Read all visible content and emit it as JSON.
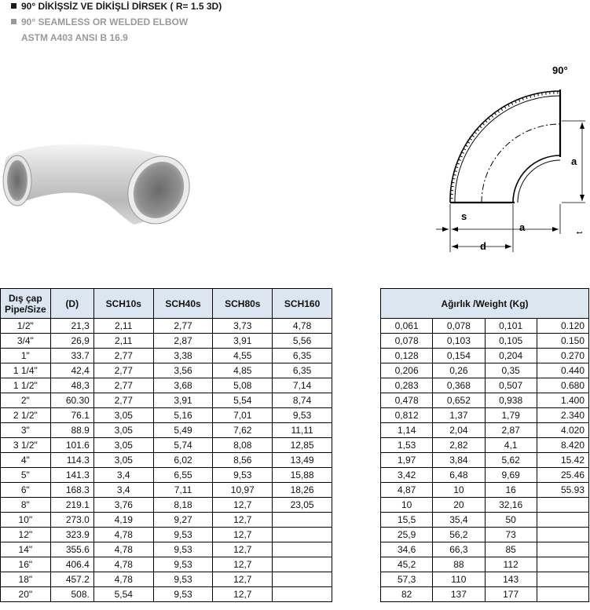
{
  "header": {
    "line1": "90° DİKİŞSİZ VE DİKİŞLİ DİRSEK ( R= 1.5 3D)",
    "line2": "90° SEAMLESS OR WELDED ELBOW",
    "line3": "ASTM A403 ANSI B 16.9"
  },
  "drawing": {
    "angle_label": "90°",
    "label_a_vertical": "a",
    "label_a_horizontal": "a",
    "label_s": "s",
    "label_d": "d",
    "label_t": "t"
  },
  "dims_table": {
    "headers": [
      "Dış çap Pipe/Size",
      "(D)",
      "SCH10s",
      "SCH40s",
      "SCH80s",
      "SCH160"
    ],
    "rows": [
      [
        "1/2\"",
        "21,3",
        "2,11",
        "2,77",
        "3,73",
        "4,78"
      ],
      [
        "3/4\"",
        "26,9",
        "2,11",
        "2,87",
        "3,91",
        "5,56"
      ],
      [
        "1\"",
        "33.7",
        "2,77",
        "3,38",
        "4,55",
        "6,35"
      ],
      [
        "1 1/4\"",
        "42,4",
        "2,77",
        "3,56",
        "4,85",
        "6,35"
      ],
      [
        "1 1/2\"",
        "48,3",
        "2,77",
        "3,68",
        "5,08",
        "7,14"
      ],
      [
        "2\"",
        "60.30",
        "2,77",
        "3,91",
        "5,54",
        "8,74"
      ],
      [
        "2 1/2\"",
        "76.1",
        "3,05",
        "5,16",
        "7,01",
        "9,53"
      ],
      [
        "3\"",
        "88.9",
        "3,05",
        "5,49",
        "7,62",
        "11,11"
      ],
      [
        "3 1/2\"",
        "101.6",
        "3,05",
        "5,74",
        "8,08",
        "12,85"
      ],
      [
        "4\"",
        "114.3",
        "3,05",
        "6,02",
        "8,56",
        "13,49"
      ],
      [
        "5\"",
        "141.3",
        "3,4",
        "6,55",
        "9,53",
        "15,88"
      ],
      [
        "6\"",
        "168.3",
        "3,4",
        "7,11",
        "10,97",
        "18,26"
      ],
      [
        "8\"",
        "219.1",
        "3,76",
        "8,18",
        "12,7",
        "23,05"
      ],
      [
        "10\"",
        "273.0",
        "4,19",
        "9,27",
        "12,7",
        ""
      ],
      [
        "12\"",
        "323.9",
        "4,78",
        "9,53",
        "12,7",
        ""
      ],
      [
        "14\"",
        "355.6",
        "4,78",
        "9,53",
        "12,7",
        ""
      ],
      [
        "16\"",
        "406.4",
        "4,78",
        "9,53",
        "12,7",
        ""
      ],
      [
        "18\"",
        "457.2",
        "4,78",
        "9,53",
        "12,7",
        ""
      ],
      [
        "20\"",
        "508.",
        "5,54",
        "9,53",
        "12,7",
        ""
      ]
    ]
  },
  "weight_table": {
    "header": "Ağırlık /Weight (Kg)",
    "rows": [
      [
        "0,061",
        "0,078",
        "0,101",
        "0.120"
      ],
      [
        "0,078",
        "0,103",
        "0,105",
        "0.150"
      ],
      [
        "0,128",
        "0,154",
        "0,204",
        "0.270"
      ],
      [
        "0,206",
        "0,26",
        "0,35",
        "0.440"
      ],
      [
        "0,283",
        "0,368",
        "0,507",
        "0.680"
      ],
      [
        "0,478",
        "0,652",
        "0,938",
        "1.400"
      ],
      [
        "0,812",
        "1,37",
        "1,79",
        "2.340"
      ],
      [
        "1,14",
        "2,04",
        "2,87",
        "4.020"
      ],
      [
        "1,53",
        "2,82",
        "4,1",
        "8.420"
      ],
      [
        "1,97",
        "3,84",
        "5,62",
        "15.42"
      ],
      [
        "3,42",
        "6,48",
        "9,69",
        "25.46"
      ],
      [
        "4,87",
        "10",
        "16",
        "55.93"
      ],
      [
        "10",
        "20",
        "32,16",
        ""
      ],
      [
        "15,5",
        "35,4",
        "50",
        ""
      ],
      [
        "25,9",
        "56,2",
        "73",
        ""
      ],
      [
        "34,6",
        "66,3",
        "85",
        ""
      ],
      [
        "45,2",
        "88",
        "112",
        ""
      ],
      [
        "57,3",
        "110",
        "143",
        ""
      ],
      [
        "82",
        "137",
        "177",
        ""
      ]
    ]
  }
}
